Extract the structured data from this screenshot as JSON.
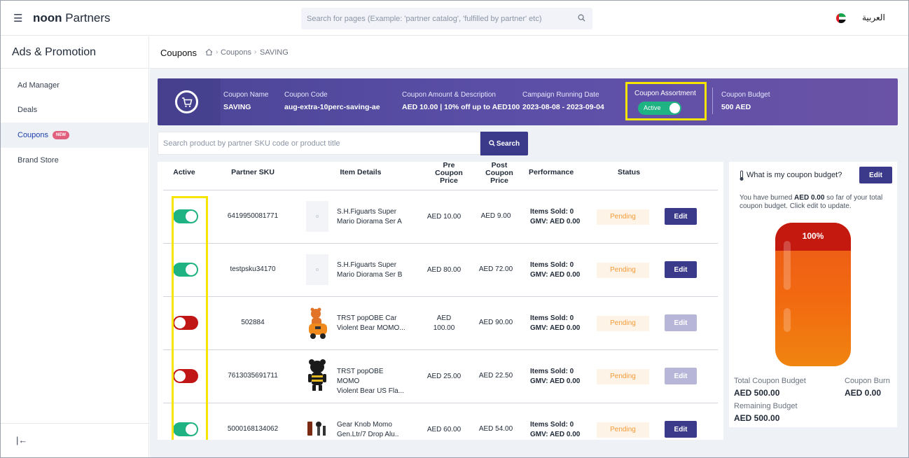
{
  "topbar": {
    "brand_bold": "noon",
    "brand_rest": " Partners",
    "search_placeholder": "Search for pages (Example: 'partner catalog', 'fulfilled by partner' etc)",
    "language": "العربية"
  },
  "sidebar": {
    "title": "Ads & Promotion",
    "items": [
      {
        "label": "Ad Manager"
      },
      {
        "label": "Deals"
      },
      {
        "label": "Coupons",
        "badge": "NEW"
      },
      {
        "label": "Brand Store"
      }
    ],
    "collapse_glyph": "|←"
  },
  "breadcrumb": {
    "title": "Coupons",
    "items": [
      "Coupons",
      "SAVING"
    ],
    "separator": "›"
  },
  "banner": {
    "coupon_name_label": "Coupon Name",
    "coupon_name": "SAVING",
    "coupon_code_label": "Coupon Code",
    "coupon_code": "aug-extra-10perc-saving-ae",
    "amount_label": "Coupon Amount & Description",
    "amount": "AED 10.00 | 10% off up to AED100",
    "date_label": "Campaign Running Date",
    "date": "2023-08-08 - 2023-09-04",
    "assortment_label": "Coupon Assortment",
    "assortment_status": "Active",
    "budget_label": "Coupon Budget",
    "budget": "500 AED"
  },
  "product_search": {
    "placeholder": "Search product by partner SKU code or product title",
    "button": "Search"
  },
  "table": {
    "headers": {
      "active": "Active",
      "sku": "Partner SKU",
      "item": "Item Details",
      "pre_1": "Pre",
      "pre_2": "Coupon",
      "pre_3": "Price",
      "post_1": "Post",
      "post_2": "Coupon",
      "post_3": "Price",
      "performance": "Performance",
      "status": "Status"
    },
    "rows": [
      {
        "active": true,
        "sku": "6419950081771",
        "title1": "S.H.Figuarts Super",
        "title2": "Mario Diorama Ser A",
        "pre": "AED 10.00",
        "pre2": "",
        "post": "AED 9.00",
        "items_sold": "Items Sold: 0",
        "gmv": "GMV: AED 0.00",
        "status": "Pending",
        "edit": "Edit"
      },
      {
        "active": true,
        "sku": "testpsku34170",
        "title1": "S.H.Figuarts Super",
        "title2": "Mario Diorama Ser B",
        "pre": "AED 80.00",
        "pre2": "",
        "post": "AED 72.00",
        "items_sold": "Items Sold: 0",
        "gmv": "GMV: AED 0.00",
        "status": "Pending",
        "edit": "Edit"
      },
      {
        "active": false,
        "sku": "502884",
        "title1": "TRST popOBE Car",
        "title2": "Violent Bear MOMO...",
        "pre": "AED",
        "pre2": "100.00",
        "post": "AED 90.00",
        "items_sold": "Items Sold: 0",
        "gmv": "GMV: AED 0.00",
        "status": "Pending",
        "edit": "Edit"
      },
      {
        "active": false,
        "sku": "7613035691711",
        "title1": "TRST popOBE MOMO",
        "title2": "Violent Bear US Fla...",
        "pre": "AED 25.00",
        "pre2": "",
        "post": "AED 22.50",
        "items_sold": "Items Sold: 0",
        "gmv": "GMV: AED 0.00",
        "status": "Pending",
        "edit": "Edit"
      },
      {
        "active": true,
        "sku": "5000168134062",
        "title1": "Gear Knob Momo",
        "title2": "Gen.Ltr/7 Drop Alu..",
        "pre": "AED 60.00",
        "pre2": "",
        "post": "AED 54.00",
        "items_sold": "Items Sold: 0",
        "gmv": "GMV: AED 0.00",
        "status": "Pending",
        "edit": "Edit"
      }
    ]
  },
  "budget_card": {
    "question": "What is my coupon budget?",
    "edit": "Edit",
    "burn_pre": "You have burned ",
    "burn_amount": "AED 0.00",
    "burn_post": " so far of your total coupon budget. Click edit to update.",
    "percent": "100%",
    "total_label": "Total Coupon Budget",
    "total_value": "AED 500.00",
    "burn_label": "Coupon Burn",
    "burn_value": "AED 0.00",
    "remaining_label": "Remaining Budget",
    "remaining_value": "AED 500.00"
  },
  "colors": {
    "accent": "#3b3a8a",
    "toggle_on": "#1fb283",
    "toggle_off": "#c01616",
    "pending": "#f39a37",
    "highlight": "#f5e500"
  }
}
